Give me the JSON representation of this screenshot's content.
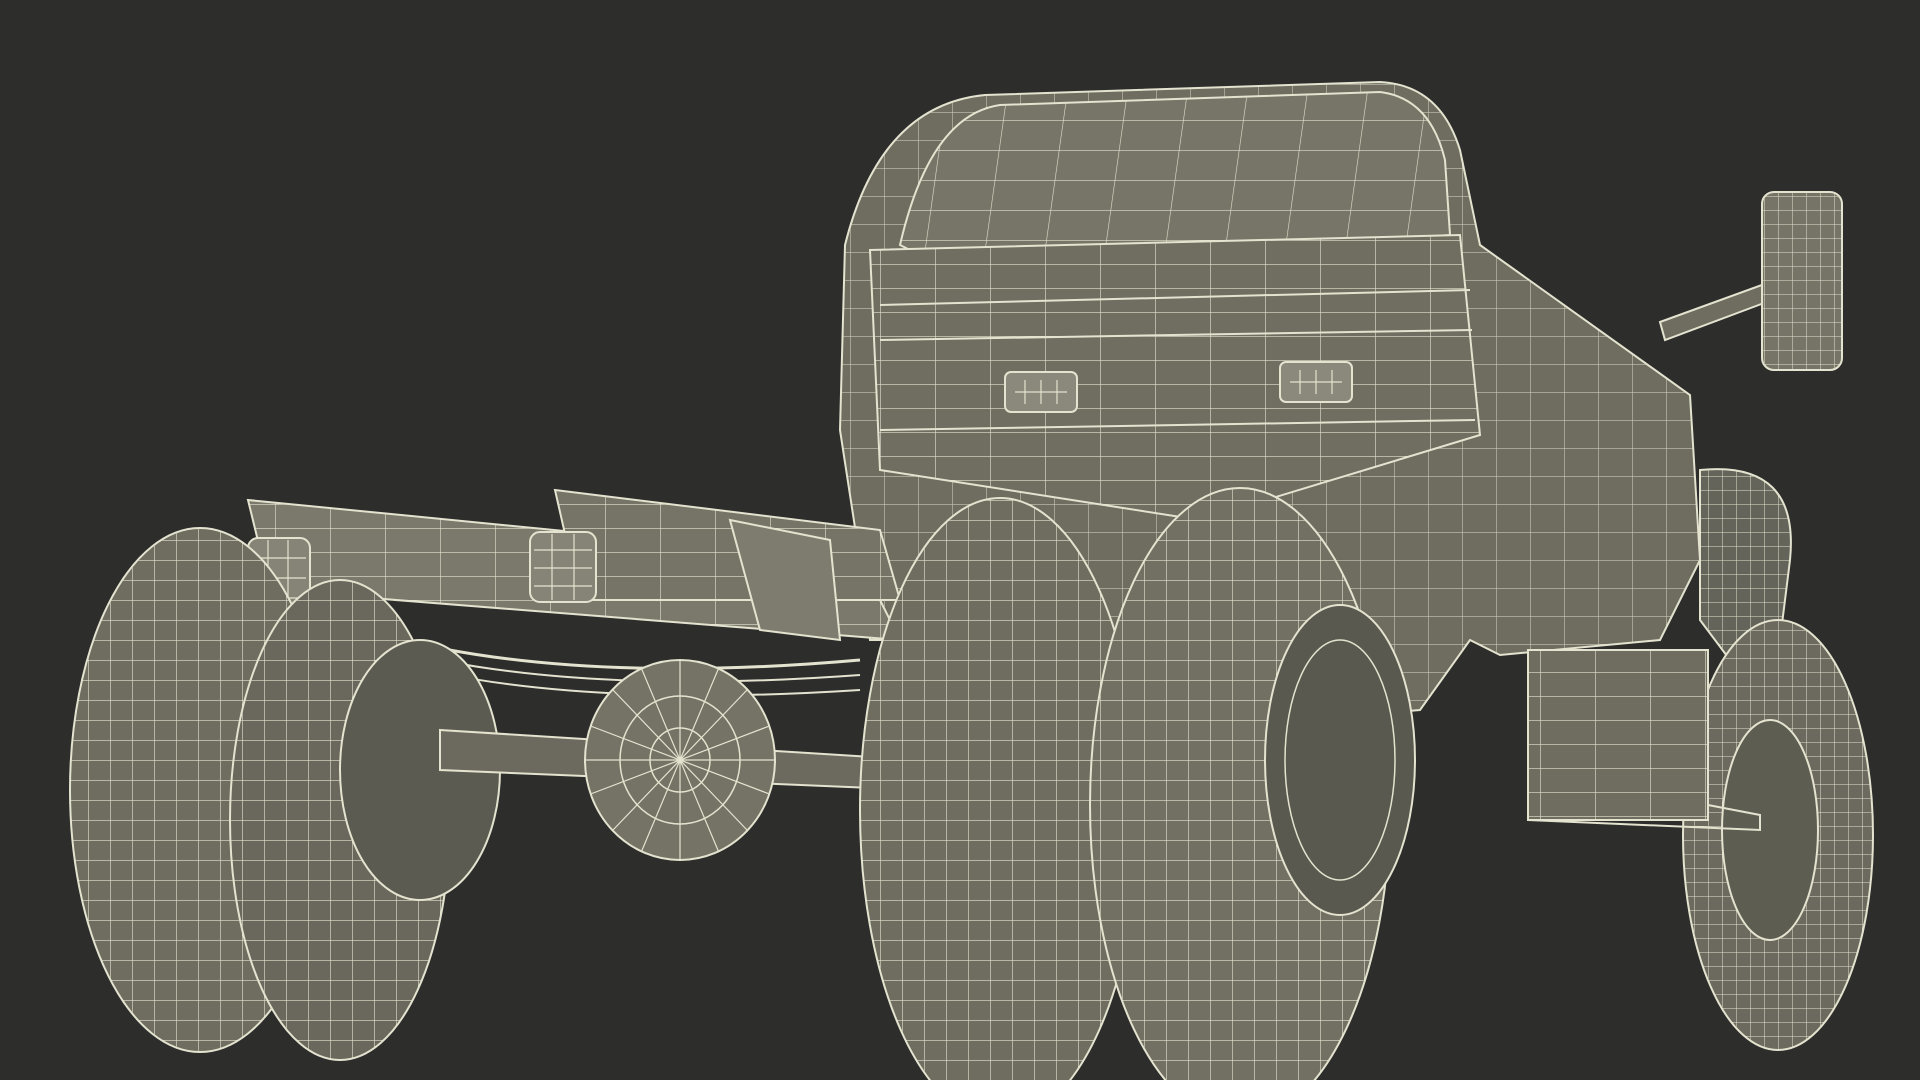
{
  "scene": {
    "background_color": "#2d2d2c",
    "model_fill_color": "#706e61",
    "model_shadow_color": "#5a594f",
    "wire_color": "#e4e3cf",
    "subject": "wireframe-render-truck-chassis-cab"
  }
}
